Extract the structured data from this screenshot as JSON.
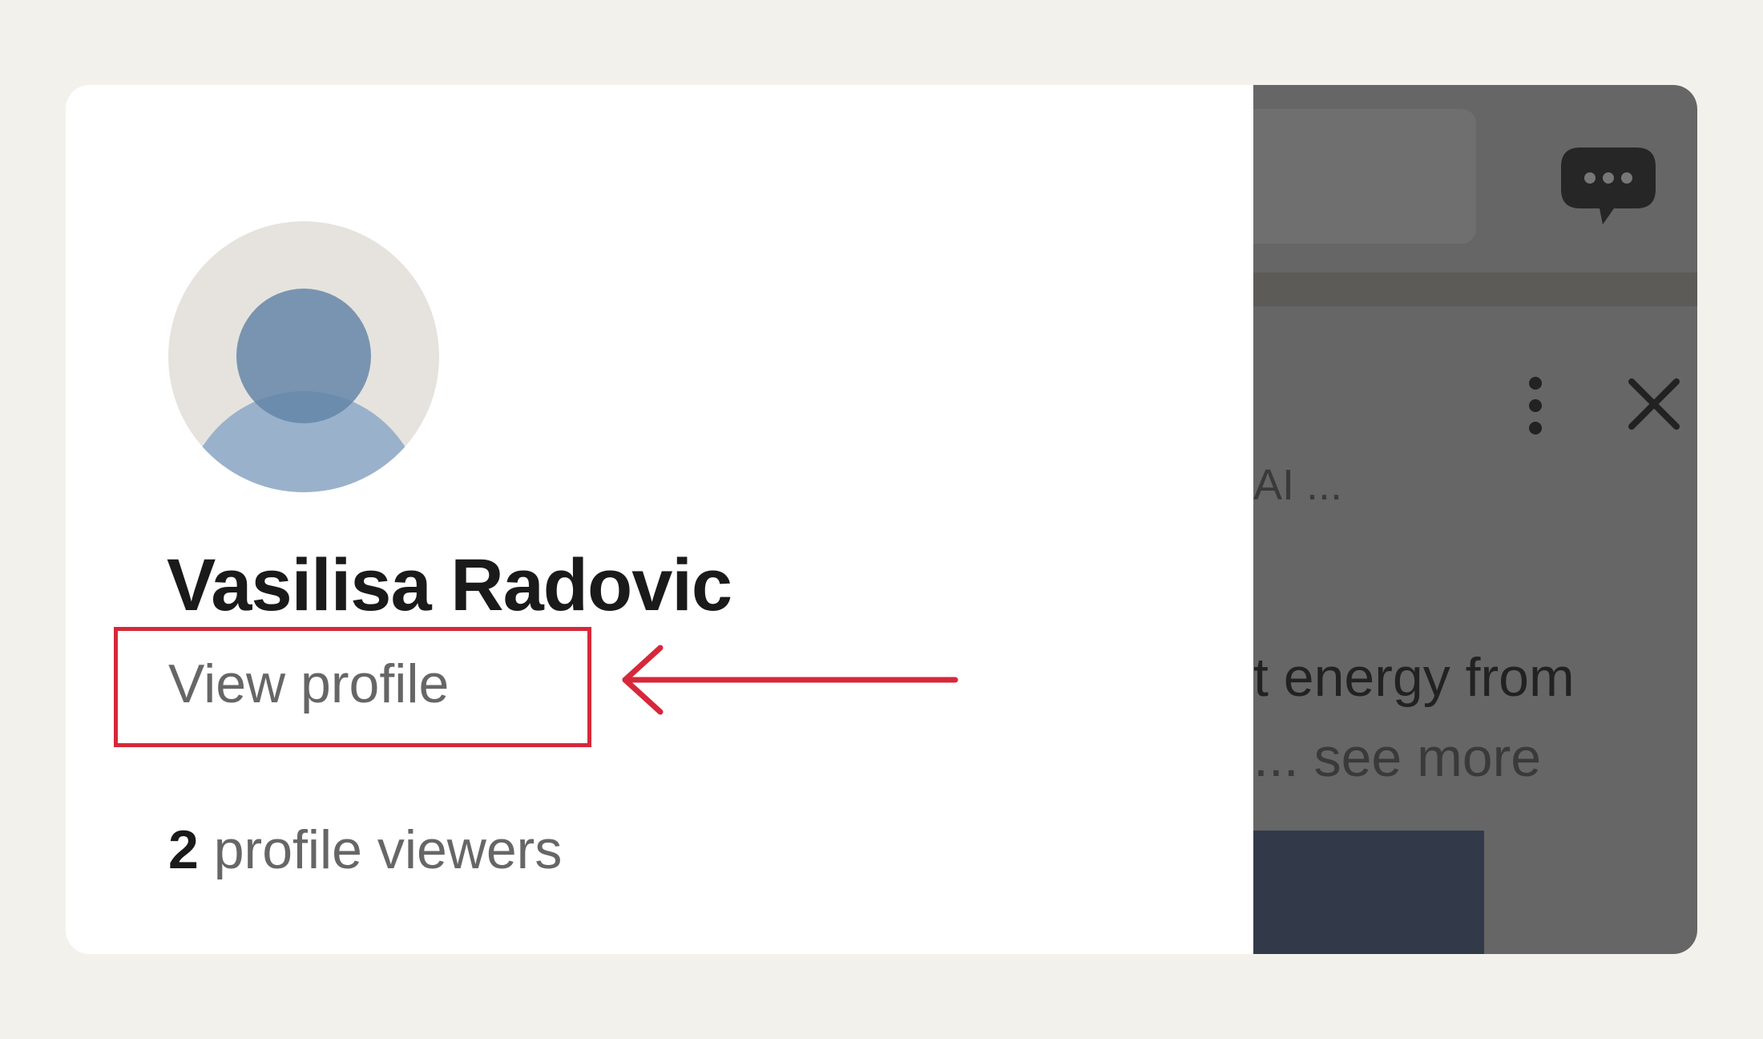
{
  "profile": {
    "name": "Vasilisa Radovic",
    "view_profile_label": "View profile",
    "viewers_count": "2",
    "viewers_label": "profile viewers"
  },
  "annotation": {
    "highlight_color": "#d6283a"
  },
  "background_feed": {
    "post_header_snippet": "AI ...",
    "post_text_snippet": "t energy from",
    "see_more_snippet": "... see more",
    "icons": [
      "chat-bubble-icon",
      "more-vertical-icon",
      "close-icon"
    ]
  }
}
